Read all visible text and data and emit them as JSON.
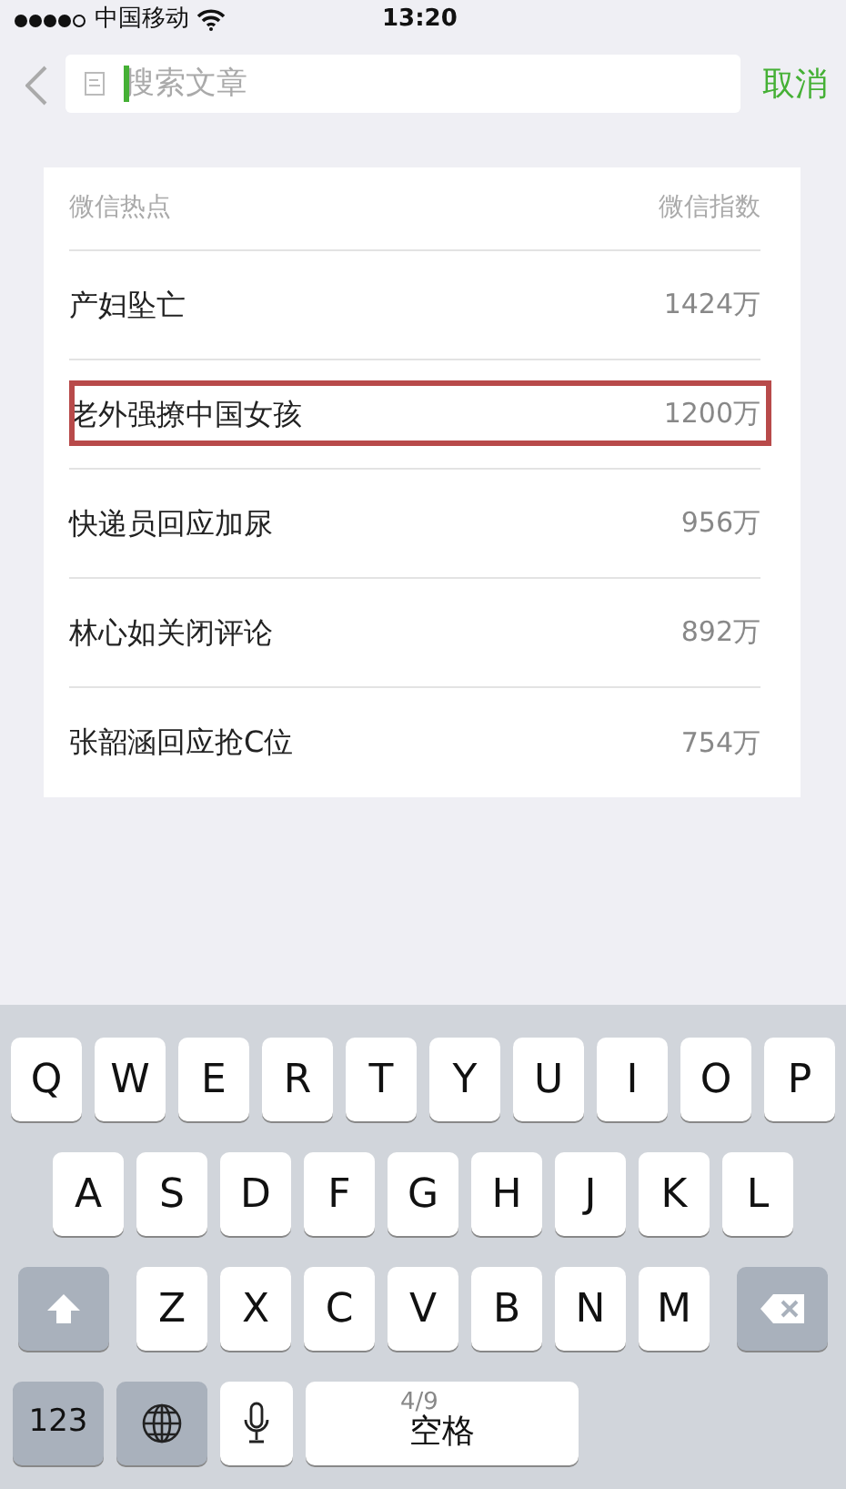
{
  "status_bar": {
    "carrier": "中国移动",
    "time": "13:20"
  },
  "search": {
    "placeholder": "搜索文章",
    "cancel": "取消"
  },
  "hot_list": {
    "columns": [
      "微信热点",
      "微信指数"
    ],
    "rows": [
      {
        "topic": "产妇坠亡",
        "index": "1424万",
        "highlighted": false
      },
      {
        "topic": "老外强撩中国女孩",
        "index": "1200万",
        "highlighted": true
      },
      {
        "topic": "快递员回应加尿",
        "index": "956万",
        "highlighted": false
      },
      {
        "topic": "林心如关闭评论",
        "index": "892万",
        "highlighted": false
      },
      {
        "topic": "张韶涵回应抢C位",
        "index": "754万",
        "highlighted": false
      }
    ]
  },
  "keyboard": {
    "top_row": [
      {
        "kind": "letter",
        "label": "Q"
      },
      {
        "kind": "letter",
        "label": "W"
      },
      {
        "kind": "letter",
        "label": "E"
      },
      {
        "kind": "letter",
        "label": "R"
      },
      {
        "kind": "letter",
        "label": "T"
      },
      {
        "kind": "letter",
        "label": "Y"
      },
      {
        "kind": "letter",
        "label": "U"
      },
      {
        "kind": "letter",
        "label": "I"
      },
      {
        "kind": "letter",
        "label": "O"
      },
      {
        "kind": "letter",
        "label": "P"
      }
    ],
    "middle_row": [
      {
        "kind": "letter",
        "label": "A"
      },
      {
        "kind": "letter",
        "label": "S"
      },
      {
        "kind": "letter",
        "label": "D"
      },
      {
        "kind": "letter",
        "label": "F"
      },
      {
        "kind": "letter",
        "label": "G"
      },
      {
        "kind": "letter",
        "label": "H"
      },
      {
        "kind": "letter",
        "label": "J"
      },
      {
        "kind": "letter",
        "label": "K"
      },
      {
        "kind": "letter",
        "label": "L"
      }
    ],
    "lower_row": [
      {
        "kind": "shift"
      },
      {
        "kind": "letter",
        "label": "Z"
      },
      {
        "kind": "letter",
        "label": "X"
      },
      {
        "kind": "letter",
        "label": "C"
      },
      {
        "kind": "letter",
        "label": "V"
      },
      {
        "kind": "letter",
        "label": "B"
      },
      {
        "kind": "letter",
        "label": "N"
      },
      {
        "kind": "letter",
        "label": "M"
      },
      {
        "kind": "delete"
      }
    ],
    "function_row": [
      {
        "kind": "numbers",
        "label": "123"
      },
      {
        "kind": "globe"
      },
      {
        "kind": "mic"
      },
      {
        "kind": "space",
        "label": "空格",
        "hint": "4/9"
      }
    ]
  }
}
